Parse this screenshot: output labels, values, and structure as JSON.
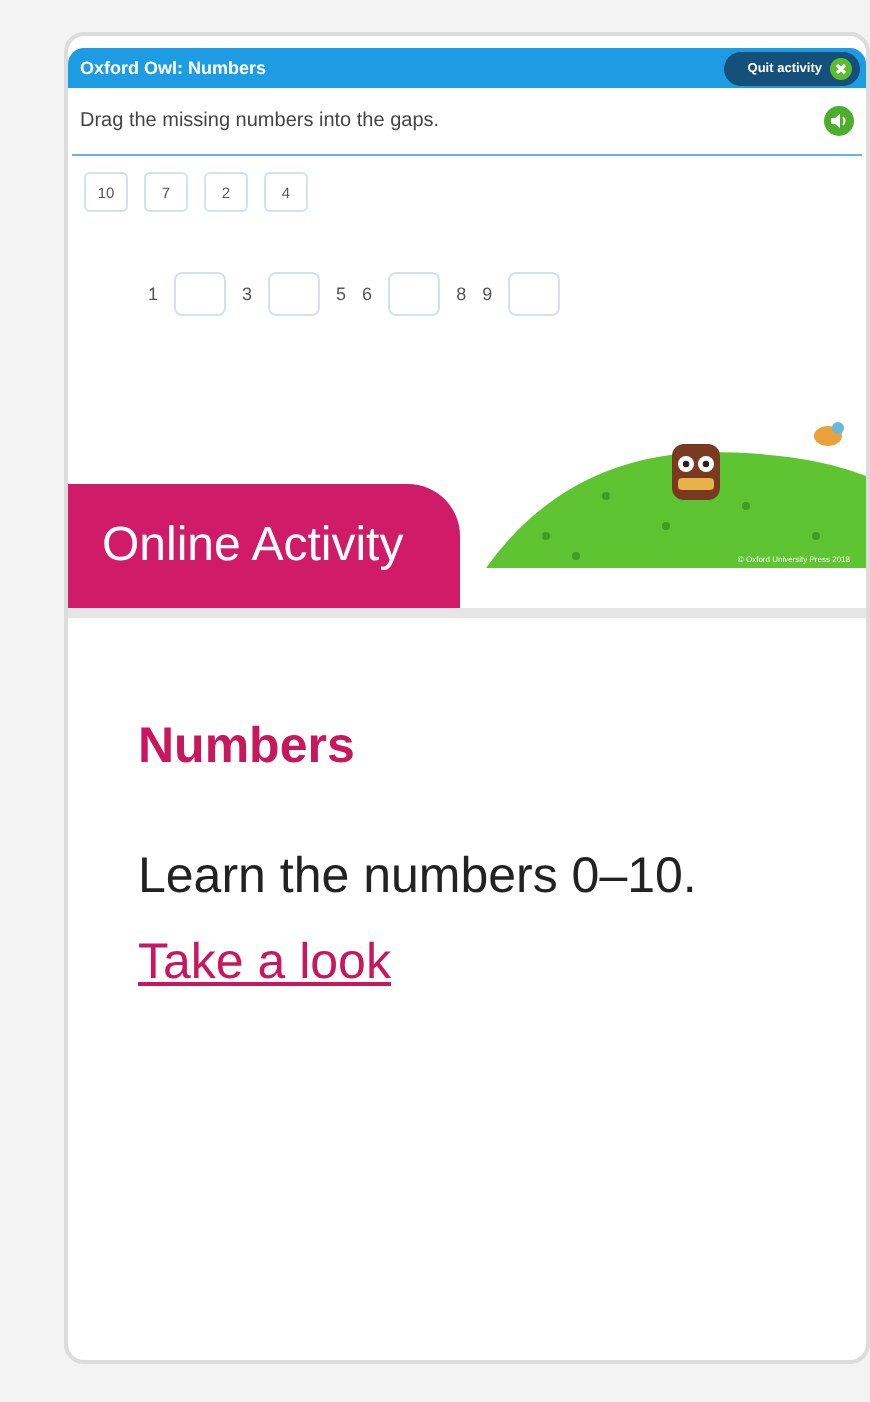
{
  "activity": {
    "title": "Oxford Owl: Numbers",
    "quit_button": "Quit activity",
    "instruction": "Drag the missing numbers into the gaps.",
    "number_tiles": [
      "10",
      "7",
      "2",
      "4"
    ],
    "sequence": [
      {
        "kind": "number",
        "text": "1"
      },
      {
        "kind": "gap"
      },
      {
        "kind": "number",
        "text": "3"
      },
      {
        "kind": "gap"
      },
      {
        "kind": "number",
        "text": "5"
      },
      {
        "kind": "number",
        "text": "6"
      },
      {
        "kind": "gap"
      },
      {
        "kind": "number",
        "text": "8"
      },
      {
        "kind": "number",
        "text": "9"
      },
      {
        "kind": "gap"
      }
    ],
    "copyright": "© Oxford University Press 2018"
  },
  "badge": "Online Activity",
  "card": {
    "heading": "Numbers",
    "description": "Learn the numbers 0–10.",
    "link": "Take a look"
  }
}
